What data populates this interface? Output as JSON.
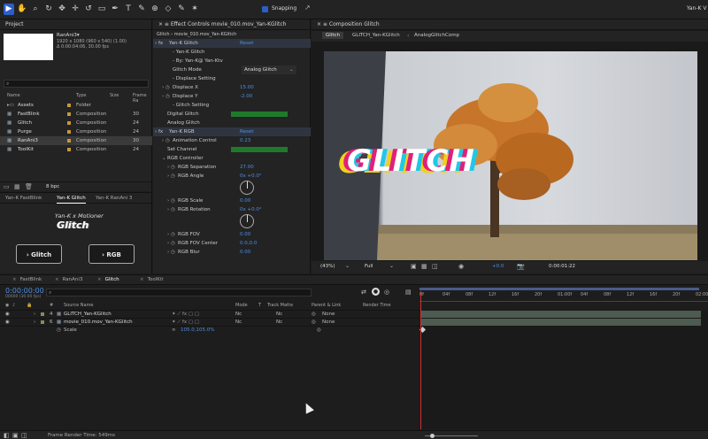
{
  "toolbar": {
    "snapping_label": "Snapping",
    "workspace_label": "Yan-K V",
    "tools": [
      "select-tool",
      "hand-tool",
      "zoom-tool",
      "orbit-tool",
      "pan-behind-tool",
      "move-tool",
      "rotate-tool",
      "rect-tool",
      "pen-tool",
      "type-tool",
      "brush-tool",
      "clone-tool",
      "eraser-tool",
      "roto-tool",
      "puppet-tool"
    ]
  },
  "project": {
    "title": "Project",
    "comp_name": "RanAni3▾",
    "comp_info1": "1920 x 1080  (960 x 540) (1.00)",
    "comp_info2": "Δ 0:00:04:06, 30.00 fps",
    "search_placeholder": "",
    "columns": {
      "name": "Name",
      "type": "Type",
      "size": "Size",
      "frame": "Frame Ra"
    },
    "items": [
      {
        "name": "Assets",
        "type": "Folder",
        "fps": "",
        "color": "#c8963c"
      },
      {
        "name": "FastBlink",
        "type": "Composition",
        "fps": "30",
        "color": "#c8963c"
      },
      {
        "name": "Glitch",
        "type": "Composition",
        "fps": "24",
        "color": "#c8963c"
      },
      {
        "name": "Purge",
        "type": "Composition",
        "fps": "24",
        "color": "#c8963c"
      },
      {
        "name": "RanAni3",
        "type": "Composition",
        "fps": "30",
        "color": "#c8963c"
      },
      {
        "name": "ToolKit",
        "type": "Composition",
        "fps": "24",
        "color": "#c8963c"
      }
    ],
    "bpc": "8 bpc"
  },
  "plugin": {
    "tabs": [
      "Yan-K FastBlink",
      "Yan-K Glitch",
      "Yan-K RanAni 3"
    ],
    "logo_line1": "Yan-K x Motioner",
    "logo_line2": "Glitch",
    "btn_glitch": "Glitch",
    "btn_rgb": "RGB"
  },
  "effects": {
    "tab_title": "Effect Controls movie_010.mov_Yan-KGlitch",
    "subtitle": "Glitch › movie_010.mov_Yan-KGlitch",
    "rows": [
      {
        "label": "Yan-K Glitch",
        "value": "Reset",
        "indent": 0,
        "fx": true,
        "hl": true
      },
      {
        "label": "- Yan-K Glitch",
        "value": "",
        "indent": 2
      },
      {
        "label": "- By: Yan-K@ Yan-Ktv",
        "value": "",
        "indent": 2
      },
      {
        "label": "Glitch Mode",
        "value": "Analog Glitch",
        "indent": 2,
        "dropdown": true
      },
      {
        "label": "- Displace Setting",
        "value": "",
        "indent": 2
      },
      {
        "label": "Displace X",
        "value": "15.00",
        "indent": 1,
        "tw": true
      },
      {
        "label": "Displace Y",
        "value": "-2.00",
        "indent": 1,
        "tw": true
      },
      {
        "label": "- Glitch Setting",
        "value": "",
        "indent": 2
      },
      {
        "label": "Digital Glitch",
        "value": "",
        "indent": 1,
        "bar": true
      },
      {
        "label": "Analog Glitch",
        "value": "",
        "indent": 1
      },
      {
        "label": "Yan-K RGB",
        "value": "Reset",
        "indent": 0,
        "fx": true,
        "hl": true
      },
      {
        "label": "Animation Control",
        "value": "0.23",
        "indent": 1,
        "tw": true
      },
      {
        "label": "Set Channel",
        "value": "",
        "indent": 1,
        "bar": true
      },
      {
        "label": "RGB Controller",
        "value": "",
        "indent": 1,
        "open": true
      },
      {
        "label": "RGB Separation",
        "value": "27.00",
        "indent": 2,
        "tw": true
      },
      {
        "label": "RGB Angle",
        "value": "0x +0.0°",
        "indent": 2,
        "tw": true,
        "dial": true
      },
      {
        "label": "RGB Scale",
        "value": "0.00",
        "indent": 2,
        "tw": true
      },
      {
        "label": "RGB Rotation",
        "value": "0x +0.0°",
        "indent": 2,
        "tw": true,
        "dial": true
      },
      {
        "label": "RGB FOV",
        "value": "0.00",
        "indent": 2,
        "tw": true
      },
      {
        "label": "RGB FOV Center",
        "value": "0.0,0.0",
        "indent": 2,
        "tw": true
      },
      {
        "label": "RGB Blur",
        "value": "0.00",
        "indent": 2,
        "tw": true
      }
    ]
  },
  "composition": {
    "tab_title": "Composition Glitch",
    "breadcrumb": [
      "Glitch",
      "GLITCH_Yan-KGlitch",
      "AnalogGlitchComp"
    ],
    "glitch_text": "GLITCH",
    "zoom": "(43%)",
    "resolution": "Full",
    "exposure": "+0.0",
    "timecode": "0:00:01:22"
  },
  "timeline": {
    "tabs": [
      "FastBlink",
      "RanAni3",
      "Glitch",
      "ToolKit"
    ],
    "active_tab": "Glitch",
    "timecode": "0:00:00:00",
    "timecode_sub": "00000 (30.00 fps)",
    "columns": {
      "src": "Source Name",
      "mode": "Mode",
      "t": "T",
      "track": "Track Matte",
      "parent": "Parent & Link",
      "render": "Render Time"
    },
    "layers": [
      {
        "num": "4",
        "name": "GLITCH_Yan-KGlitch",
        "mode": "Nc",
        "track": "Nc",
        "parent": "None"
      },
      {
        "num": "6",
        "name": "movie_010.mov_Yan-KGlitch",
        "mode": "Nc",
        "track": "Nc",
        "parent": "None"
      }
    ],
    "scale_label": "Scale",
    "scale_value": "105.0,105.0%",
    "ruler": [
      "0f",
      "04f",
      "08f",
      "12f",
      "16f",
      "20f",
      "01:00f",
      "04f",
      "08f",
      "12f",
      "16f",
      "20f",
      "02:00"
    ],
    "footer": "Frame Render Time: 549ms"
  }
}
